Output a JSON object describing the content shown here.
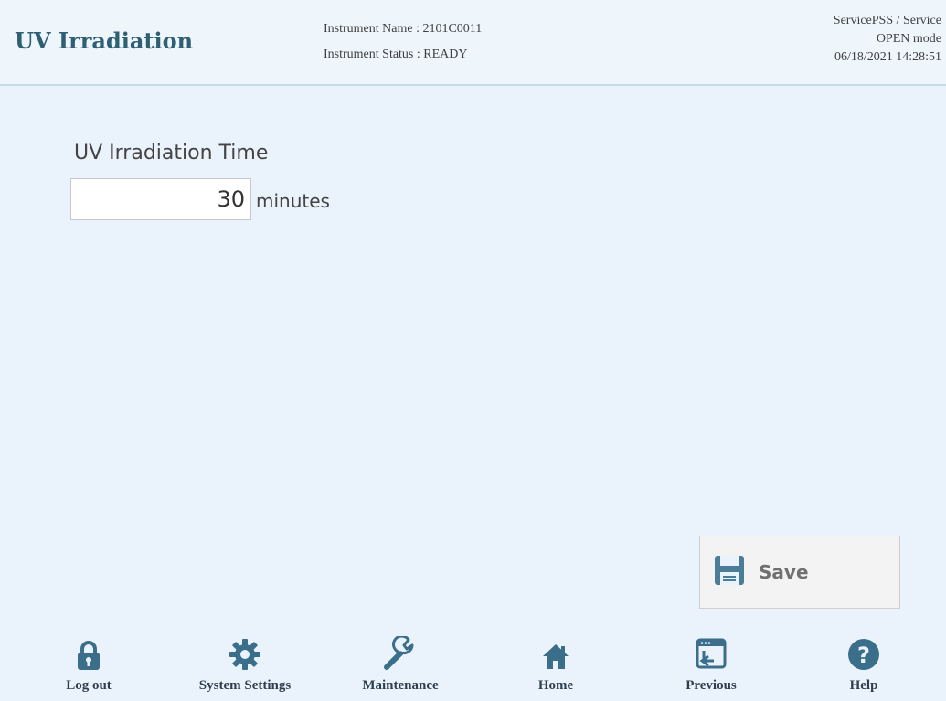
{
  "header": {
    "title": "UV Irradiation",
    "instrument_name": "Instrument Name : 2101C0011",
    "instrument_status": "Instrument Status : READY",
    "user": "ServicePSS / Service",
    "mode": "OPEN mode",
    "datetime": "06/18/2021 14:28:51"
  },
  "form": {
    "label": "UV Irradiation Time",
    "value": "30",
    "unit": "minutes"
  },
  "actions": {
    "save_label": "Save",
    "save_icon": "floppy-disk-icon"
  },
  "footer": {
    "items": [
      {
        "label": "Log out",
        "icon": "lock-icon"
      },
      {
        "label": "System Settings",
        "icon": "gear-icon"
      },
      {
        "label": "Maintenance",
        "icon": "wrench-icon"
      },
      {
        "label": "Home",
        "icon": "home-icon"
      },
      {
        "label": "Previous",
        "icon": "previous-window-icon"
      },
      {
        "label": "Help",
        "icon": "help-icon"
      }
    ]
  },
  "colors": {
    "background": "#eaf3fb",
    "title": "#2e5f73",
    "icon": "#3a6e8a"
  }
}
